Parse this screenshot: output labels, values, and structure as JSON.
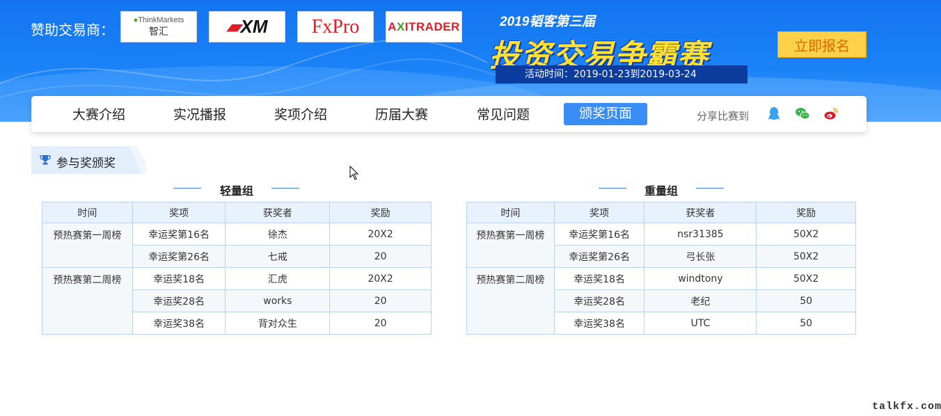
{
  "banner": {
    "sponsor_label": "赞助交易商：",
    "sponsors": {
      "thinkmarkets_top": "ThinkMarkets",
      "thinkmarkets_bottom": "智汇",
      "xm": "XM",
      "fxpro": "FxPro",
      "axitrader_a": "A",
      "axitrader_x": "X",
      "axitrader_rest": "ITRADER"
    },
    "contest_subtitle": "2019韬客第三届",
    "contest_title": "投资交易争霸赛",
    "contest_time": "活动时间：2019-01-23到2019-03-24",
    "signup_button": "立即报名"
  },
  "nav": {
    "items": [
      "大赛介绍",
      "实况播报",
      "奖项介绍",
      "历届大赛",
      "常见问题",
      "颁奖页面"
    ],
    "active_index": 5,
    "share_label": "分享比赛到",
    "share_icons": [
      "qq-icon",
      "wechat-icon",
      "weibo-icon"
    ]
  },
  "section": {
    "title": "参与奖颁奖"
  },
  "groups": [
    {
      "name": "轻量组",
      "headers": [
        "时间",
        "奖项",
        "获奖者",
        "奖励"
      ],
      "periods": [
        {
          "label": "预热赛第一周榜",
          "rows": [
            {
              "award": "幸运奖第16名",
              "winner": "徐杰",
              "reward": "20X2"
            },
            {
              "award": "幸运奖第26名",
              "winner": "七戒",
              "reward": "20"
            }
          ]
        },
        {
          "label": "预热赛第二周榜",
          "rows": [
            {
              "award": "幸运奖18名",
              "winner": "汇虎",
              "reward": "20X2"
            },
            {
              "award": "幸运奖28名",
              "winner": "works",
              "reward": "20"
            },
            {
              "award": "幸运奖38名",
              "winner": "背对众生",
              "reward": "20"
            }
          ]
        }
      ]
    },
    {
      "name": "重量组",
      "headers": [
        "时间",
        "奖项",
        "获奖者",
        "奖励"
      ],
      "periods": [
        {
          "label": "预热赛第一周榜",
          "rows": [
            {
              "award": "幸运奖第16名",
              "winner": "nsr31385",
              "reward": "50X2"
            },
            {
              "award": "幸运奖第26名",
              "winner": "弓长张",
              "reward": "50X2"
            }
          ]
        },
        {
          "label": "预热赛第二周榜",
          "rows": [
            {
              "award": "幸运奖18名",
              "winner": "windtony",
              "reward": "50X2"
            },
            {
              "award": "幸运奖28名",
              "winner": "老纪",
              "reward": "50"
            },
            {
              "award": "幸运奖38名",
              "winner": "UTC",
              "reward": "50"
            }
          ]
        }
      ]
    }
  ],
  "watermark": "talkfx.com",
  "colors": {
    "banner_blue": "#1a82f7",
    "nav_active": "#3a8df5",
    "signup_yellow": "#ffd04a",
    "contest_title_yellow": "#ffe033",
    "table_header_bg": "#e8f2fc",
    "table_border": "#b9d4ec"
  }
}
